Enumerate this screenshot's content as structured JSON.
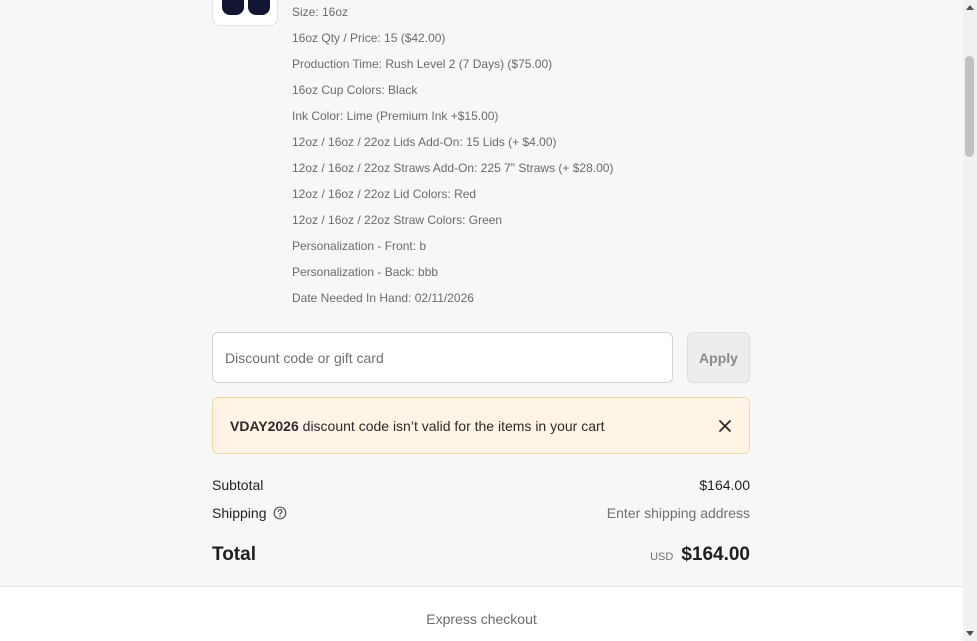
{
  "product": {
    "thumbnail_icon": "product-thumbnail-cups",
    "options": [
      "Size: 16oz",
      "16oz Qty / Price: 15 ($42.00)",
      "Production Time: Rush Level 2 (7 Days) ($75.00)",
      "16oz Cup Colors: Black",
      "Ink Color: Lime (Premium Ink +$15.00)",
      "12oz / 16oz / 22oz Lids Add-On: 15 Lids (+ $4.00)",
      "12oz / 16oz / 22oz Straws Add-On: 225 7\" Straws (+ $28.00)",
      "12oz / 16oz / 22oz Lid Colors: Red",
      "12oz / 16oz / 22oz Straw Colors: Green",
      "Personalization - Front: b",
      "Personalization - Back: bbb",
      "Date Needed In Hand: 02/11/2026"
    ]
  },
  "discount": {
    "placeholder": "Discount code or gift card",
    "value": "",
    "apply_label": "Apply"
  },
  "warning": {
    "code": "VDAY2026",
    "message": " discount code isn’t valid for the items in your cart",
    "close_icon": "close-icon",
    "bg_color": "#fff4e5"
  },
  "summary": {
    "subtotal_label": "Subtotal",
    "subtotal_value": "$164.00",
    "shipping_label": "Shipping",
    "shipping_help_icon": "help-circle-icon",
    "shipping_value": "Enter shipping address",
    "total_label": "Total",
    "currency": "USD",
    "total_value": "$164.00"
  },
  "express": {
    "label": "Express checkout"
  }
}
